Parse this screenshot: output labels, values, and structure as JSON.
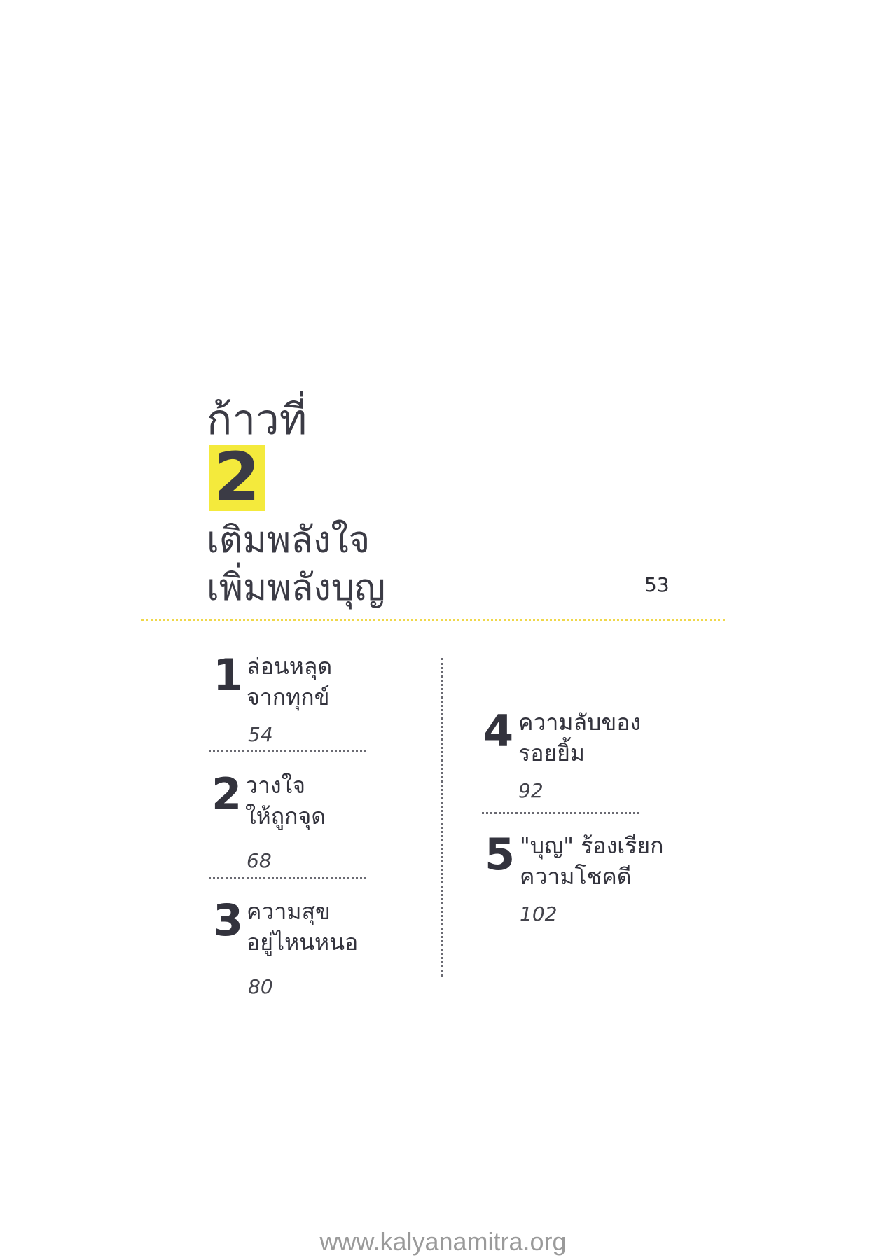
{
  "heading": {
    "step_label": "ก้าวที่",
    "step_number": "2",
    "line1": "เติมพลังใจ",
    "line2": "เพิ่มพลังบุญ"
  },
  "page_number": "53",
  "chapters": [
    {
      "number": "1",
      "line1": "ล่อนหลุด",
      "line2": "จากทุกข์",
      "page": "54"
    },
    {
      "number": "2",
      "line1": "วางใจ",
      "line2": "ให้ถูกจุด",
      "page": "68"
    },
    {
      "number": "3",
      "line1": "ความสุข",
      "line2": "อยู่ไหนหนอ",
      "page": "80"
    },
    {
      "number": "4",
      "line1": "ความลับของ",
      "line2": "รอยยิ้ม",
      "page": "92"
    },
    {
      "number": "5",
      "line1": "\"บุญ\" ร้องเรียก",
      "line2": "ความโชคดี",
      "page": "102"
    }
  ],
  "colors": {
    "highlight": "#f4ea3c",
    "header_rule": "#f0d84a",
    "text": "#3b3b45"
  },
  "footer": {
    "url": "www.kalyanamitra.org"
  }
}
